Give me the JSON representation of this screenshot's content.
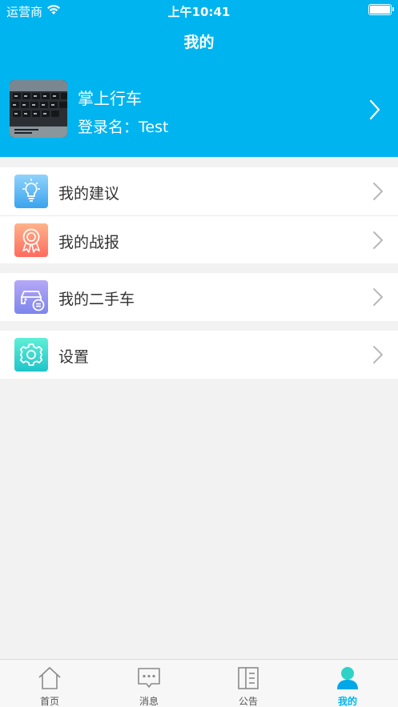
{
  "status_bar": {
    "carrier": "运营商",
    "time": "上午10:41"
  },
  "nav": {
    "title": "我的"
  },
  "profile": {
    "name": "掌上行车",
    "login": "登录名：Test"
  },
  "menu": {
    "suggestions": "我的建议",
    "reports": "我的战报",
    "used_cars": "我的二手车",
    "settings": "设置"
  },
  "tabs": [
    {
      "label": "首页",
      "icon": "home-icon"
    },
    {
      "label": "消息",
      "icon": "message-icon"
    },
    {
      "label": "公告",
      "icon": "notice-icon"
    },
    {
      "label": "我的",
      "icon": "profile-icon",
      "active": true
    }
  ],
  "colors": {
    "accent": "#00b4ef",
    "background": "#f2f2f2"
  }
}
